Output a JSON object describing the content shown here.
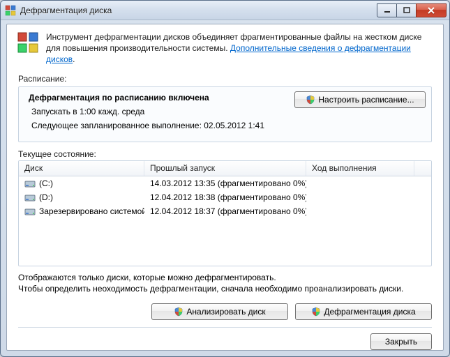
{
  "window_title": "Дефрагментация диска",
  "info": {
    "text": "Инструмент дефрагментации дисков объединяет фрагментированные файлы на жестком диске для повышения производительности системы. ",
    "link": "Дополнительные сведения о дефрагментации дисков"
  },
  "labels": {
    "schedule": "Расписание:",
    "current_state": "Текущее состояние:"
  },
  "schedule": {
    "title": "Дефрагментация по расписанию включена",
    "run_at": "Запускать в 1:00 кажд. среда",
    "next_run": "Следующее запланированное выполнение: 02.05.2012 1:41",
    "configure_btn": "Настроить расписание..."
  },
  "table": {
    "headers": {
      "disk": "Диск",
      "last_run": "Прошлый запуск",
      "progress": "Ход выполнения"
    },
    "rows": [
      {
        "name": "(C:)",
        "icon": "hdd",
        "last_run": "14.03.2012 13:35 (фрагментировано 0%)",
        "progress": ""
      },
      {
        "name": "(D:)",
        "icon": "hdd",
        "last_run": "12.04.2012 18:38 (фрагментировано 0%)",
        "progress": ""
      },
      {
        "name": "Зарезервировано системой",
        "icon": "hdd",
        "last_run": "12.04.2012 18:37 (фрагментировано 0%)",
        "progress": ""
      }
    ]
  },
  "hint": {
    "line1": "Отображаются только диски, которые можно дефрагментировать.",
    "line2": "Чтобы определить неоходимость дефрагментации, сначала необходимо проанализировать диски."
  },
  "buttons": {
    "analyze": "Анализировать диск",
    "defrag": "Дефрагментация диска",
    "close": "Закрыть"
  }
}
